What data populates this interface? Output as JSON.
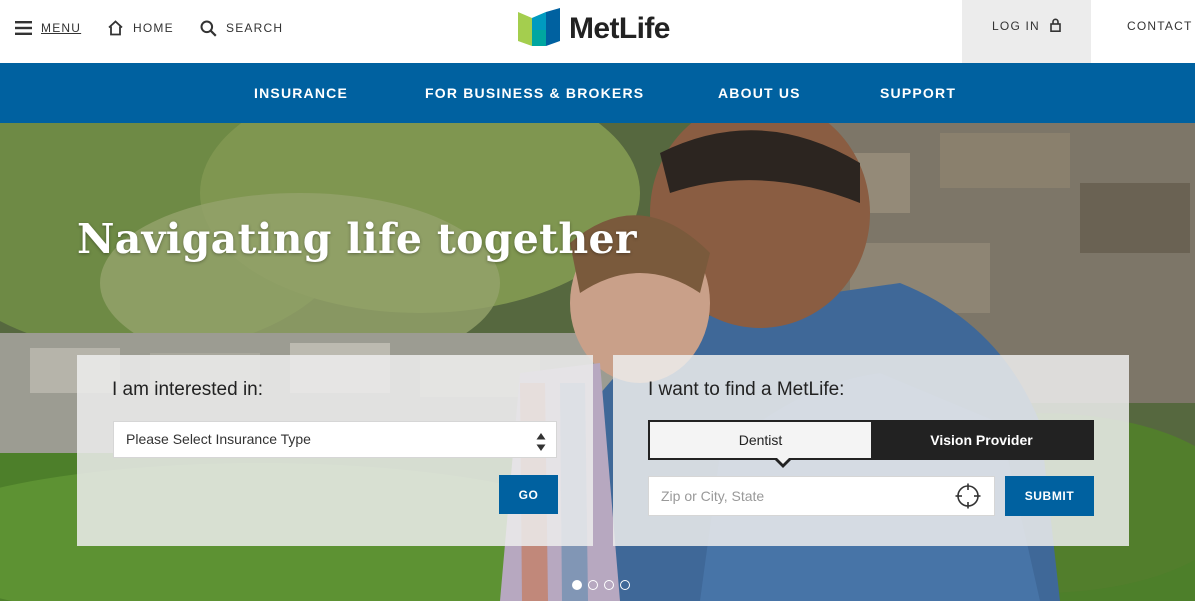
{
  "header": {
    "menu_label": "MENU",
    "home_label": "HOME",
    "search_label": "SEARCH",
    "brand": "MetLife",
    "login_label": "LOG IN",
    "contact_label": "CONTACT"
  },
  "nav": {
    "items": [
      {
        "label": "INSURANCE"
      },
      {
        "label": "FOR BUSINESS & BROKERS"
      },
      {
        "label": "ABOUT US"
      },
      {
        "label": "SUPPORT"
      }
    ]
  },
  "hero": {
    "headline": "Navigating life together"
  },
  "interest_panel": {
    "title": "I am interested in:",
    "select_value": "Please Select Insurance Type",
    "go_label": "GO"
  },
  "find_panel": {
    "title": "I want to find a MetLife:",
    "options": [
      {
        "label": "Dentist",
        "selected": true
      },
      {
        "label": "Vision Provider",
        "selected": false
      }
    ],
    "zip_placeholder": "Zip or City, State",
    "submit_label": "SUBMIT"
  },
  "carousel": {
    "slide_count": 4,
    "active_slide": 1
  },
  "colors": {
    "brand_blue": "#0061a0",
    "logo_green": "#a4ce4e",
    "logo_teal": "#00a6a0",
    "logo_dark_blue": "#0061a0"
  },
  "icons": {
    "menu": "hamburger-icon",
    "home": "home-icon",
    "search": "search-icon",
    "login": "lock-icon",
    "location": "crosshair-icon",
    "select": "up-down-arrows-icon"
  }
}
